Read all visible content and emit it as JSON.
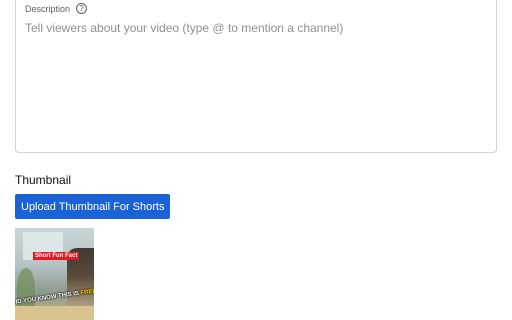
{
  "description": {
    "label": "Description",
    "help_icon": "question-circle-icon",
    "placeholder": "Tell viewers about your video (type @ to mention a channel)",
    "value": ""
  },
  "thumbnail": {
    "heading": "Thumbnail",
    "upload_button_label": "Upload Thumbnail For Shorts",
    "preview": {
      "tag_text": "Short Fun Fact",
      "caption_prefix": "DID YOU KNOW THIS IS ",
      "caption_highlight": "FREE"
    }
  },
  "colors": {
    "accent": "#1a62d6",
    "tag_red": "#e01b24",
    "highlight_yellow": "#ffd400"
  }
}
